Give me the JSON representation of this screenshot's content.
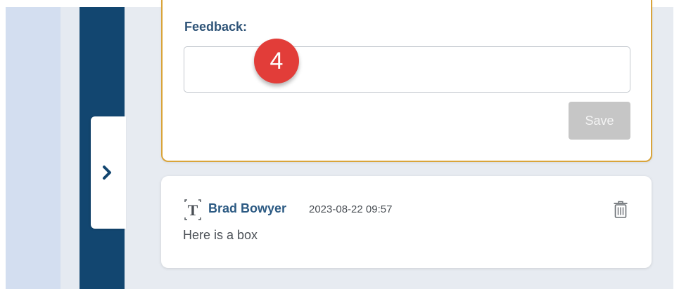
{
  "feedback": {
    "label": "Feedback:",
    "value": "",
    "placeholder": "",
    "save_label": "Save",
    "save_enabled": false
  },
  "annotation": {
    "step_number": "4",
    "color": "#e23d39"
  },
  "sidebar": {
    "expand_icon": "chevron-right-icon",
    "nav_color": "#124670"
  },
  "comments": [
    {
      "type_icon": "text-type-icon",
      "author": "Brad Bowyer",
      "timestamp": "2023-08-22 09:57",
      "body": "Here is a box",
      "action_icon": "trash-icon"
    }
  ],
  "colors": {
    "accent_border": "#d9a43a",
    "label_blue": "#2f5478",
    "author_blue": "#2c5a83",
    "disabled_button": "#c6c6c6"
  }
}
